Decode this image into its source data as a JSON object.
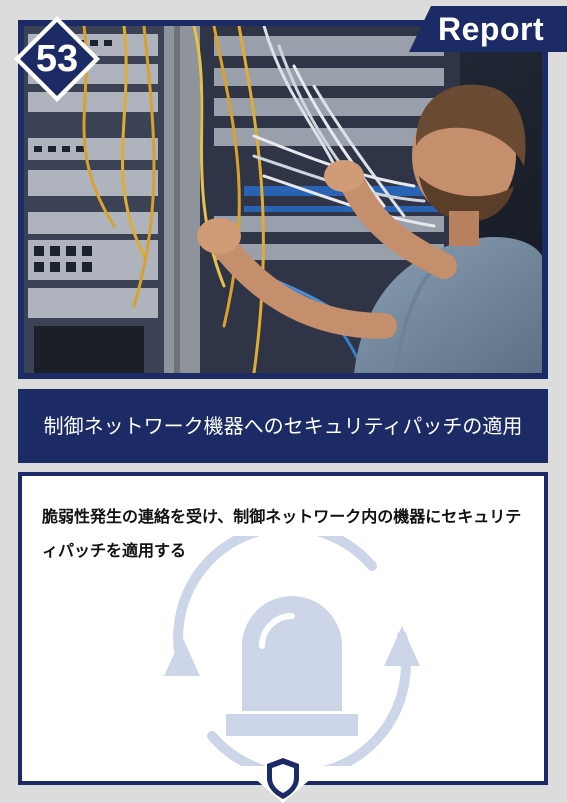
{
  "card": {
    "number": "53",
    "tag": "Report",
    "title": "制御ネットワーク機器へのセキュリティパッチの適用",
    "description": "脆弱性発生の連絡を受け、制御ネットワーク内の機器にセキュリティパッチを適用する"
  },
  "icons": {
    "photo": "technician-patching-network-rack-photo",
    "background": "alarm-light-refresh-icon",
    "emblem": "shield-icon"
  },
  "colors": {
    "navy": "#1c2a66",
    "icon_tint": "#cdd5e8",
    "background": "#dcdcdc"
  }
}
